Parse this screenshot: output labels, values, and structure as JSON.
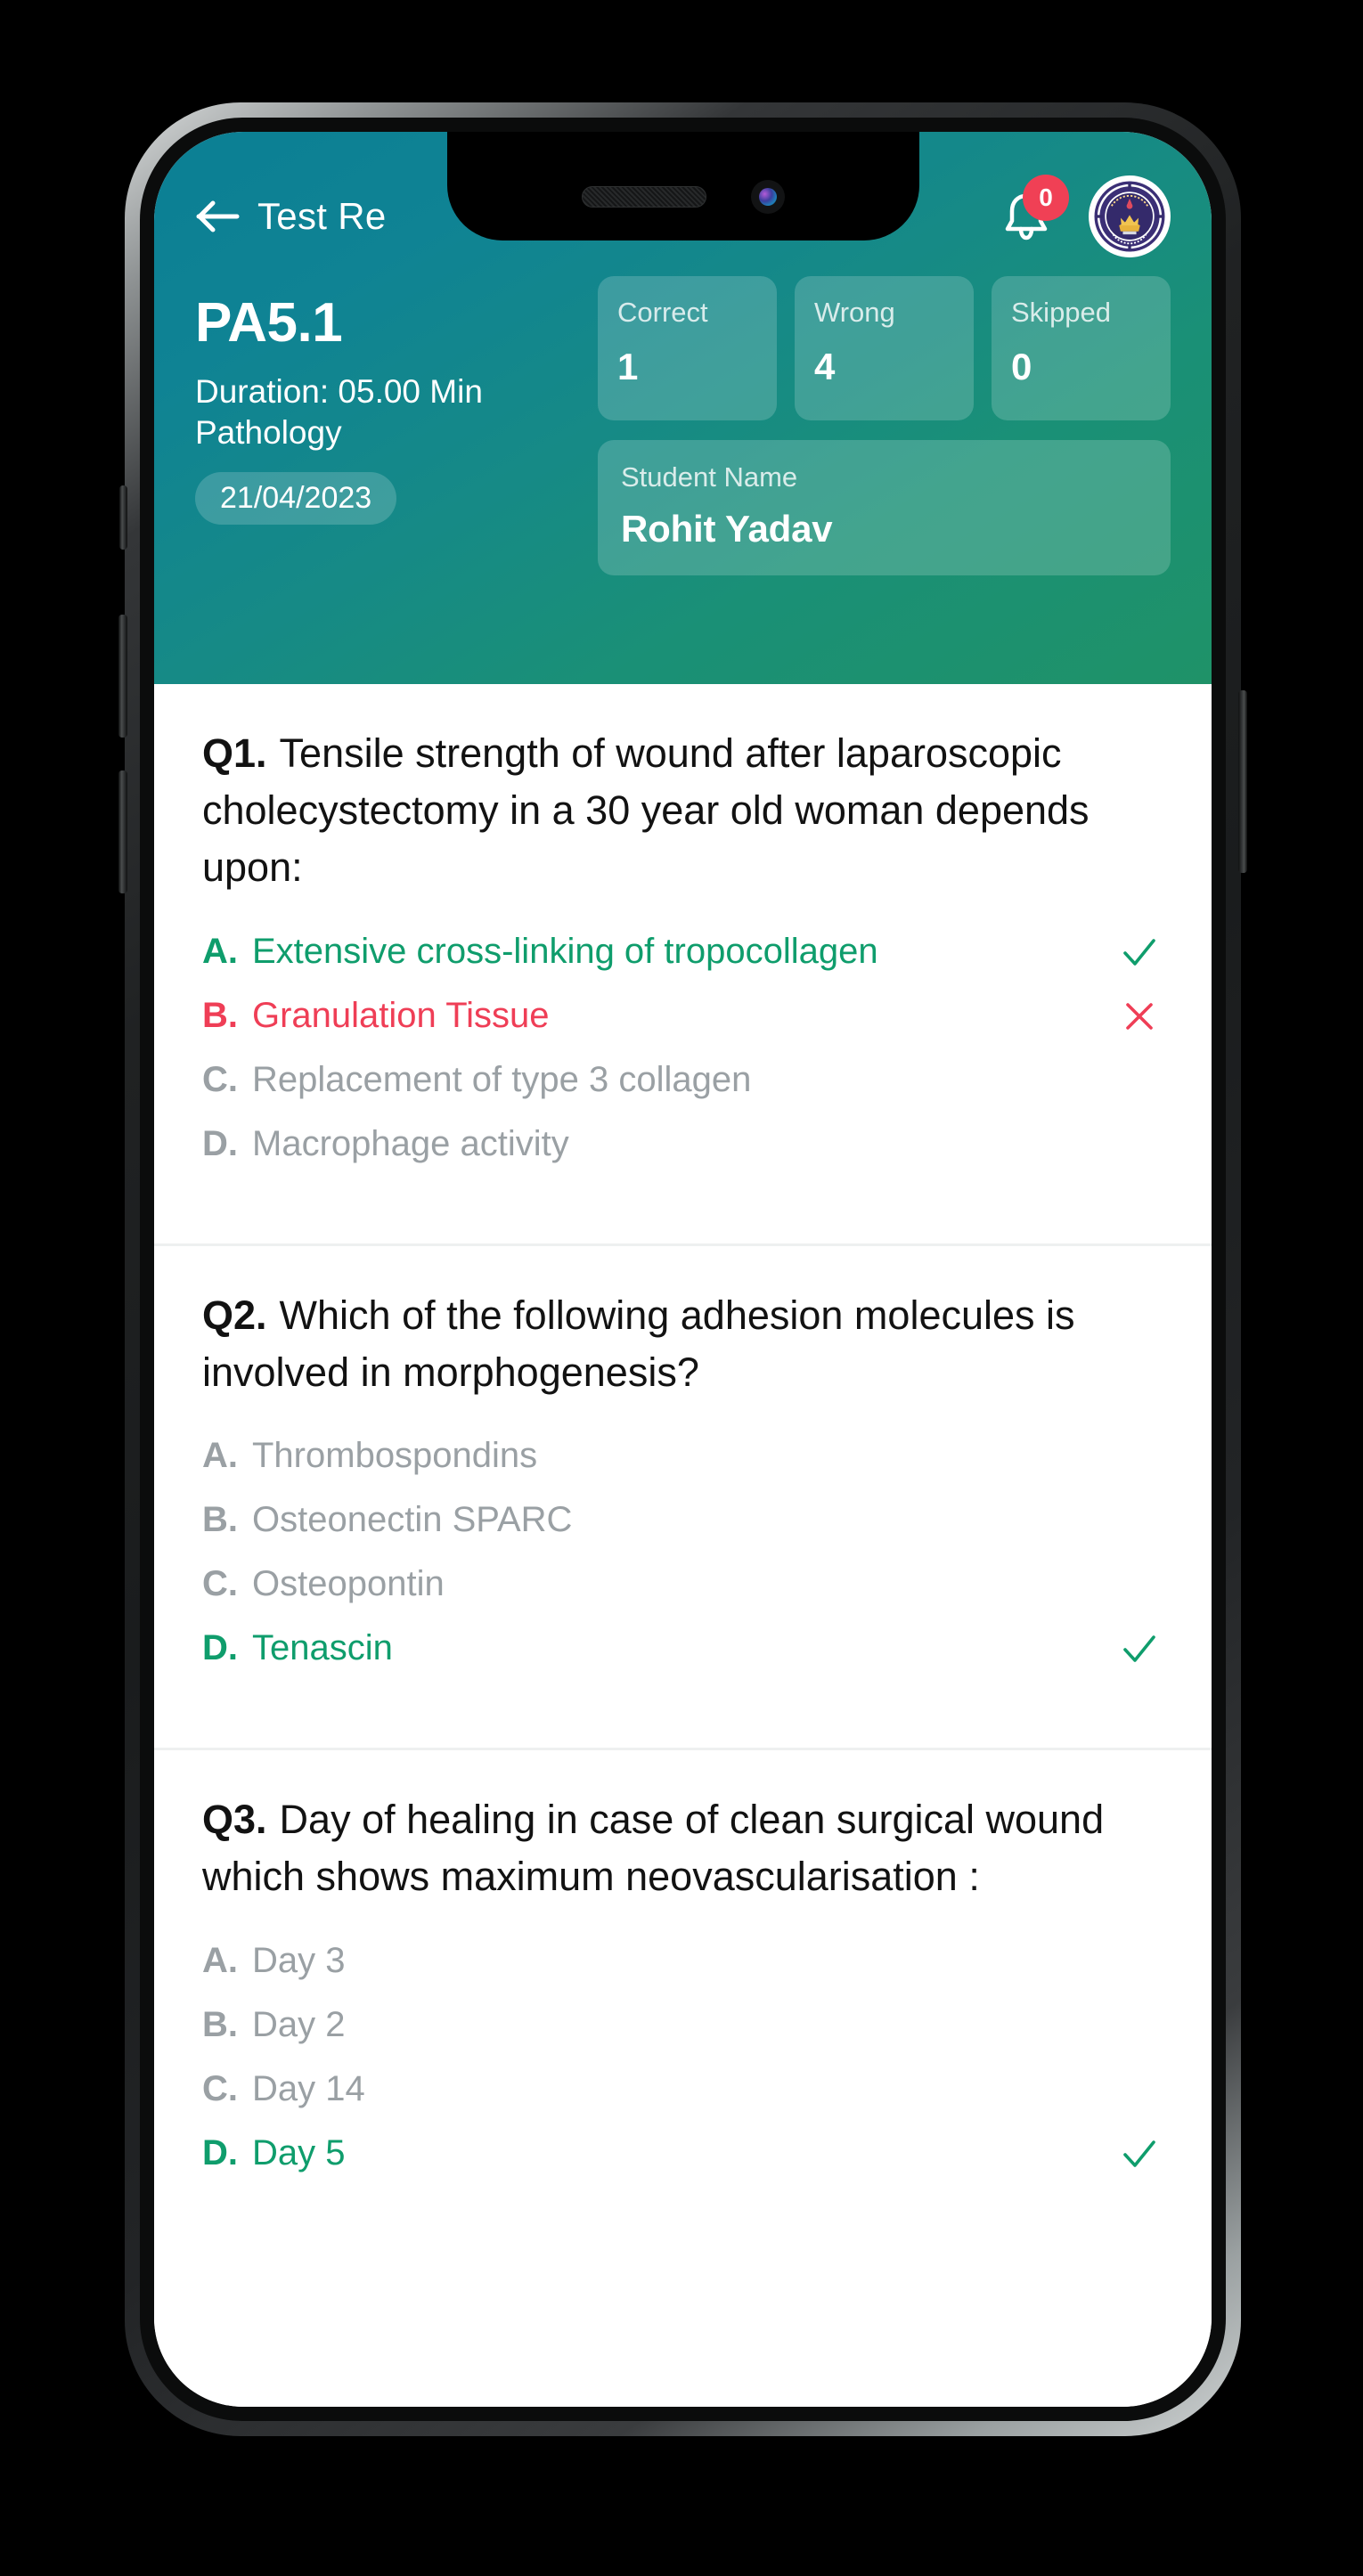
{
  "nav": {
    "back_icon": "arrow-left-icon",
    "title": "Test Re",
    "bell_icon": "bell-icon",
    "bell_badge": "0",
    "avatar_icon": "college-logo-avatar"
  },
  "header": {
    "test_code": "PA5.1",
    "duration": "Duration: 05.00 Min",
    "subject": "Pathology",
    "date": "21/04/2023",
    "stats": [
      {
        "label": "Correct",
        "value": "1"
      },
      {
        "label": "Wrong",
        "value": "4"
      },
      {
        "label": "Skipped",
        "value": "0"
      }
    ],
    "student": {
      "label": "Student Name",
      "value": "Rohit Yadav"
    }
  },
  "colors": {
    "header_gradient_start": "#0b7f94",
    "header_gradient_end": "#1f9268",
    "correct": "#0f9d6c",
    "wrong": "#ef3e56",
    "neutral": "#9aa0a4",
    "badge": "#f04055"
  },
  "questions": [
    {
      "num": "Q1.",
      "text": "Tensile strength of wound after laparoscopic cholecystectomy in a 30 year old woman depends upon:",
      "options": [
        {
          "letter": "A.",
          "text": "Extensive cross-linking of tropocollagen",
          "state": "correct",
          "mark": "check-icon"
        },
        {
          "letter": "B.",
          "text": "Granulation Tissue",
          "state": "wrong",
          "mark": "cross-icon"
        },
        {
          "letter": "C.",
          "text": "Replacement of type 3 collagen",
          "state": "neutral",
          "mark": ""
        },
        {
          "letter": "D.",
          "text": "Macrophage activity",
          "state": "neutral",
          "mark": ""
        }
      ]
    },
    {
      "num": "Q2.",
      "text": "Which of the following adhesion molecules is involved in morphogenesis?",
      "options": [
        {
          "letter": "A.",
          "text": "Thrombospondins",
          "state": "neutral",
          "mark": ""
        },
        {
          "letter": "B.",
          "text": "Osteonectin SPARC",
          "state": "neutral",
          "mark": ""
        },
        {
          "letter": "C.",
          "text": "Osteopontin",
          "state": "neutral",
          "mark": ""
        },
        {
          "letter": "D.",
          "text": "Tenascin",
          "state": "correct",
          "mark": "check-icon"
        }
      ]
    },
    {
      "num": "Q3.",
      "text": "Day of healing in case of clean surgical wound which shows maximum neovascularisation :",
      "options": [
        {
          "letter": "A.",
          "text": "Day 3",
          "state": "neutral",
          "mark": ""
        },
        {
          "letter": "B.",
          "text": "Day 2",
          "state": "neutral",
          "mark": ""
        },
        {
          "letter": "C.",
          "text": "Day 14",
          "state": "neutral",
          "mark": ""
        },
        {
          "letter": "D.",
          "text": "Day 5",
          "state": "correct",
          "mark": "check-icon"
        }
      ]
    }
  ]
}
